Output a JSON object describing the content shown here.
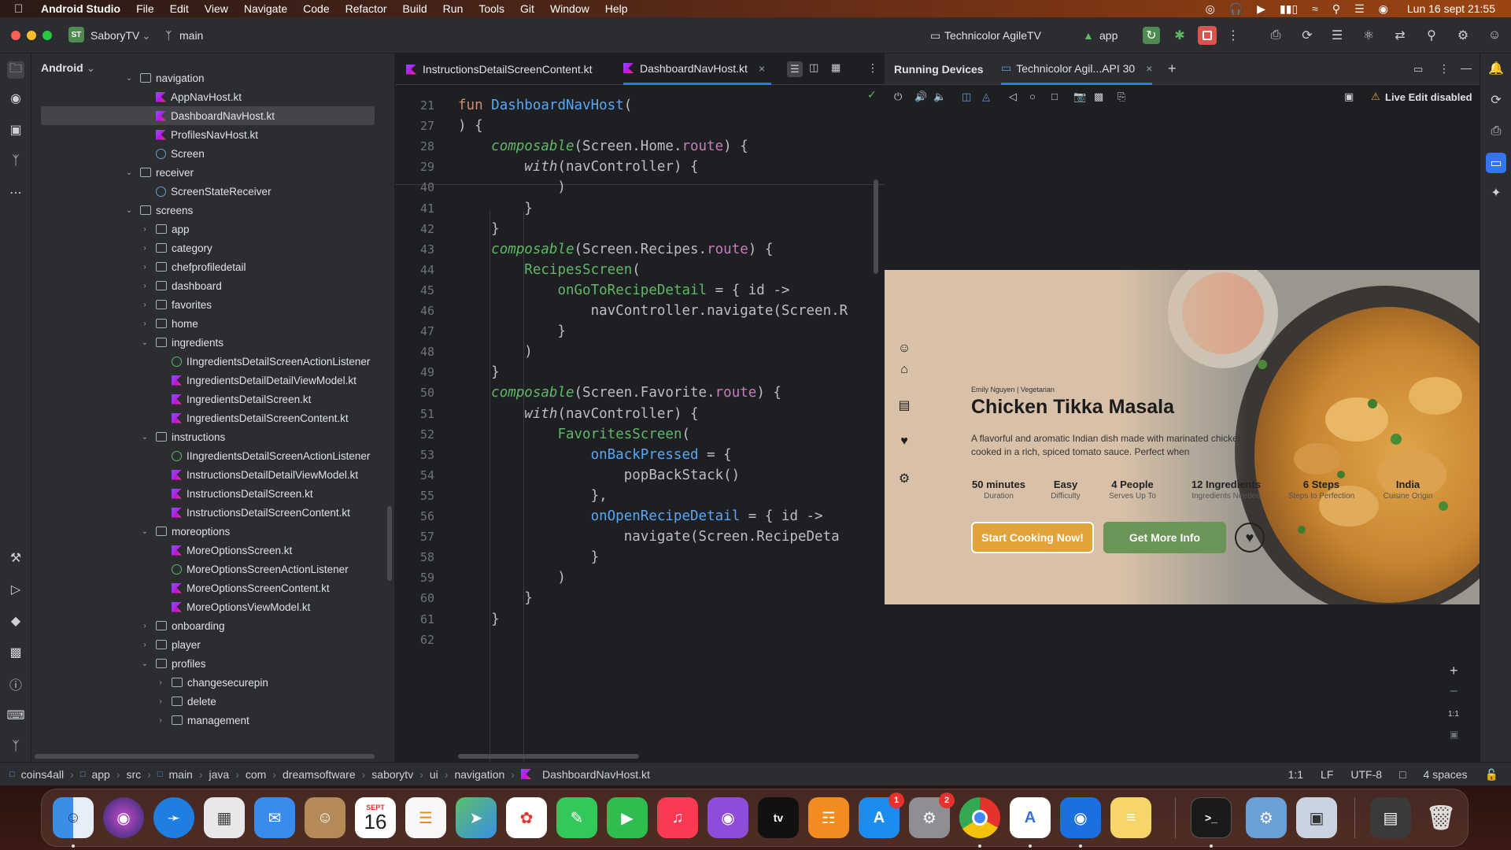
{
  "menubar": {
    "app_name": "Android Studio",
    "items": [
      "File",
      "Edit",
      "View",
      "Navigate",
      "Code",
      "Refactor",
      "Build",
      "Run",
      "Tools",
      "Git",
      "Window",
      "Help"
    ],
    "clock": "Lun 16 sept  21:55"
  },
  "toolbar": {
    "project_badge": "ST",
    "project_name": "SaboryTV",
    "branch": "main",
    "device": "Technicolor AgileTV",
    "run_config": "app"
  },
  "project_panel": {
    "view": "Android",
    "tree": [
      {
        "label": "navigation",
        "type": "folder",
        "depth": 1,
        "expanded": true
      },
      {
        "label": "AppNavHost.kt",
        "type": "kt",
        "depth": 2
      },
      {
        "label": "DashboardNavHost.kt",
        "type": "kt",
        "depth": 2,
        "selected": true
      },
      {
        "label": "ProfilesNavHost.kt",
        "type": "kt",
        "depth": 2
      },
      {
        "label": "Screen",
        "type": "class",
        "depth": 2
      },
      {
        "label": "receiver",
        "type": "folder",
        "depth": 1,
        "expanded": true
      },
      {
        "label": "ScreenStateReceiver",
        "type": "class",
        "depth": 2
      },
      {
        "label": "screens",
        "type": "folder",
        "depth": 1,
        "expanded": true
      },
      {
        "label": "app",
        "type": "folder",
        "depth": 2,
        "expanded": false
      },
      {
        "label": "category",
        "type": "folder",
        "depth": 2,
        "expanded": false
      },
      {
        "label": "chefprofiledetail",
        "type": "folder",
        "depth": 2,
        "expanded": false
      },
      {
        "label": "dashboard",
        "type": "folder",
        "depth": 2,
        "expanded": false
      },
      {
        "label": "favorites",
        "type": "folder",
        "depth": 2,
        "expanded": false
      },
      {
        "label": "home",
        "type": "folder",
        "depth": 2,
        "expanded": false
      },
      {
        "label": "ingredients",
        "type": "folder",
        "depth": 2,
        "expanded": true
      },
      {
        "label": "IIngredientsDetailScreenActionListener",
        "type": "interface",
        "depth": 3
      },
      {
        "label": "IngredientsDetailDetailViewModel.kt",
        "type": "kt",
        "depth": 3
      },
      {
        "label": "IngredientsDetailScreen.kt",
        "type": "kt",
        "depth": 3
      },
      {
        "label": "IngredientsDetailScreenContent.kt",
        "type": "kt",
        "depth": 3
      },
      {
        "label": "instructions",
        "type": "folder",
        "depth": 2,
        "expanded": true
      },
      {
        "label": "IIngredientsDetailScreenActionListener",
        "type": "interface",
        "depth": 3
      },
      {
        "label": "InstructionsDetailDetailViewModel.kt",
        "type": "kt",
        "depth": 3
      },
      {
        "label": "InstructionsDetailScreen.kt",
        "type": "kt",
        "depth": 3
      },
      {
        "label": "InstructionsDetailScreenContent.kt",
        "type": "kt",
        "depth": 3
      },
      {
        "label": "moreoptions",
        "type": "folder",
        "depth": 2,
        "expanded": true
      },
      {
        "label": "MoreOptionsScreen.kt",
        "type": "kt",
        "depth": 3
      },
      {
        "label": "MoreOptionsScreenActionListener",
        "type": "interface",
        "depth": 3
      },
      {
        "label": "MoreOptionsScreenContent.kt",
        "type": "kt",
        "depth": 3
      },
      {
        "label": "MoreOptionsViewModel.kt",
        "type": "kt",
        "depth": 3
      },
      {
        "label": "onboarding",
        "type": "folder",
        "depth": 2,
        "expanded": false
      },
      {
        "label": "player",
        "type": "folder",
        "depth": 2,
        "expanded": false
      },
      {
        "label": "profiles",
        "type": "folder",
        "depth": 2,
        "expanded": true
      },
      {
        "label": "changesecurepin",
        "type": "folder",
        "depth": 3,
        "expanded": false
      },
      {
        "label": "delete",
        "type": "folder",
        "depth": 3,
        "expanded": false
      },
      {
        "label": "management",
        "type": "folder",
        "depth": 3,
        "expanded": false
      }
    ]
  },
  "editor": {
    "tabs": [
      {
        "label": "InstructionsDetailScreenContent.kt",
        "active": false
      },
      {
        "label": "DashboardNavHost.kt",
        "active": true
      }
    ],
    "lines": [
      {
        "n": "21",
        "html": "<span class=\"kw\">fun </span><span class=\"fn\">DashboardNavHost</span>("
      },
      {
        "n": "27",
        "html": ") {"
      },
      {
        "n": "28",
        "html": "    <span class=\"cp it\">composable</span>(Screen.Home.<span class=\"pr\">route</span>) {"
      },
      {
        "n": "29",
        "html": "        <span class=\"it\">with</span>(navController) {"
      },
      {
        "n": "40",
        "html": "            )"
      },
      {
        "n": "41",
        "html": "        }"
      },
      {
        "n": "42",
        "html": "    }"
      },
      {
        "n": "43",
        "html": "    <span class=\"cp it\">composable</span>(Screen.Recipes.<span class=\"pr\">route</span>) {"
      },
      {
        "n": "44",
        "html": "        <span class=\"cp\">RecipesScreen</span>("
      },
      {
        "n": "45",
        "html": "            <span class=\"cp\">onGoToRecipeDetail</span> = { id ->"
      },
      {
        "n": "46",
        "html": "                navController.navigate(Screen.R"
      },
      {
        "n": "47",
        "html": "            }"
      },
      {
        "n": "48",
        "html": "        )"
      },
      {
        "n": "49",
        "html": "    }"
      },
      {
        "n": "50",
        "html": "    <span class=\"cp it\">composable</span>(Screen.Favorite.<span class=\"pr\">route</span>) {"
      },
      {
        "n": "51",
        "html": "        <span class=\"it\">with</span>(navController) {"
      },
      {
        "n": "52",
        "html": "            <span class=\"cp\">FavoritesScreen</span>("
      },
      {
        "n": "53",
        "html": "                <span class=\"fn\">onBackPressed</span> = {"
      },
      {
        "n": "54",
        "html": "                    popBackStack()"
      },
      {
        "n": "55",
        "html": "                },"
      },
      {
        "n": "56",
        "html": "                <span class=\"fn\">onOpenRecipeDetail</span> = { id ->"
      },
      {
        "n": "57",
        "html": "                    navigate(Screen.RecipeDeta"
      },
      {
        "n": "58",
        "html": "                }"
      },
      {
        "n": "59",
        "html": "            )"
      },
      {
        "n": "60",
        "html": "        }"
      },
      {
        "n": "61",
        "html": "    }"
      },
      {
        "n": "62",
        "html": ""
      }
    ]
  },
  "devices": {
    "title": "Running Devices",
    "device_tab": "Technicolor Agil...API 30",
    "live_edit": "Live Edit disabled",
    "zoom_label": "1:1"
  },
  "app_screen": {
    "author_line": "Emily Nguyen | Vegetarian",
    "title": "Chicken Tikka Masala",
    "description": "A flavorful and aromatic Indian dish made with marinated chicken cooked in a rich, spiced tomato sauce. Perfect when",
    "stats": [
      {
        "value": "50 minutes",
        "label": "Duration"
      },
      {
        "value": "Easy",
        "label": "Difficulty"
      },
      {
        "value": "4 People",
        "label": "Serves Up To"
      },
      {
        "value": "12 Ingredients",
        "label": "Ingredients Needed"
      },
      {
        "value": "6 Steps",
        "label": "Steps to Perfection"
      },
      {
        "value": "India",
        "label": "Cuisine Origin"
      }
    ],
    "start_button": "Start Cooking Now!",
    "info_button": "Get More Info",
    "colors": {
      "start": "#e2a43a",
      "info": "#6b9457",
      "background": "#d8c1a8"
    }
  },
  "statusbar": {
    "breadcrumb": [
      "coins4all",
      "app",
      "src",
      "main",
      "java",
      "com",
      "dreamsoftware",
      "saborytv",
      "ui",
      "navigation",
      "DashboardNavHost.kt"
    ],
    "position": "1:1",
    "line_sep": "LF",
    "encoding": "UTF-8",
    "indent": "4 spaces"
  },
  "dock": {
    "calendar_month": "SEPT",
    "calendar_day": "16",
    "appstore_badge": "1",
    "settings_badge": "2"
  }
}
